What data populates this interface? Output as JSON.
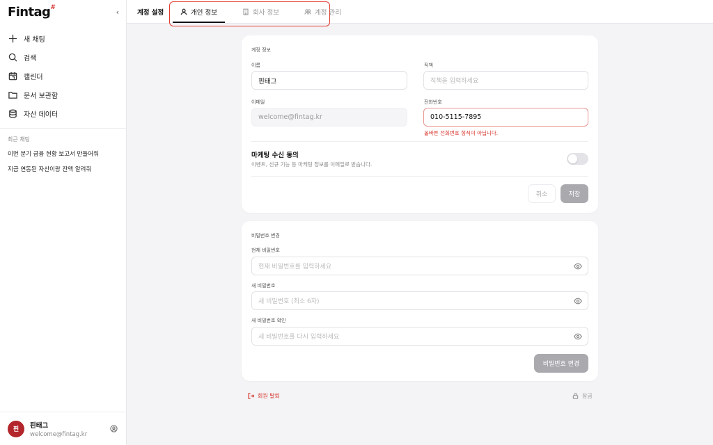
{
  "sidebar": {
    "logo": "Fintag",
    "logo_mark": "#",
    "nav": [
      {
        "label": "새 채팅",
        "icon": "plus-icon"
      },
      {
        "label": "검색",
        "icon": "search-icon"
      },
      {
        "label": "캘린더",
        "icon": "calendar-icon"
      },
      {
        "label": "문서 보관함",
        "icon": "folder-icon"
      },
      {
        "label": "자산 데이터",
        "icon": "database-icon"
      }
    ],
    "recent_title": "최근 채팅",
    "recent": [
      "이번 분기 금융 현황 보고서 만들어줘",
      "지금 연동된 자산이랑 잔액 알려줘"
    ],
    "user": {
      "avatar_initial": "핀",
      "name": "핀태그",
      "email": "welcome@fintag.kr"
    }
  },
  "header": {
    "title": "계정 설정",
    "tabs": [
      {
        "label": "개인 정보",
        "active": true,
        "icon": "user-icon"
      },
      {
        "label": "회사 정보",
        "active": false,
        "icon": "building-icon"
      },
      {
        "label": "계정 관리",
        "active": false,
        "icon": "users-icon"
      }
    ]
  },
  "account": {
    "section_title": "계정 정보",
    "name_label": "이름",
    "name_value": "핀태그",
    "position_label": "직책",
    "position_placeholder": "직책을 입력하세요",
    "email_label": "이메일",
    "email_value": "welcome@fintag.kr",
    "phone_label": "전화번호",
    "phone_value": "010-5115-7895",
    "phone_error": "올바른 전화번호 형식이 아닙니다.",
    "marketing_title": "마케팅 수신 동의",
    "marketing_desc": "이벤트, 신규 기능 등 마케팅 정보를 이메일로 받습니다.",
    "marketing_on": false,
    "cancel_label": "취소",
    "save_label": "저장"
  },
  "password": {
    "section_title": "비밀번호 변경",
    "current_label": "현재 비밀번호",
    "current_placeholder": "현재 비밀번호를 입력하세요",
    "new_label": "새 비밀번호",
    "new_placeholder": "새 비밀번호 (최소 6자)",
    "confirm_label": "새 비밀번호 확인",
    "confirm_placeholder": "새 비밀번호를 다시 입력하세요",
    "submit_label": "비밀번호 변경"
  },
  "footer": {
    "withdraw_label": "회원 탈퇴",
    "logout_label": "잠금"
  },
  "colors": {
    "accent_red": "#d7332a",
    "avatar_bg": "#b3262b",
    "highlight_box": "#e23a2e"
  }
}
